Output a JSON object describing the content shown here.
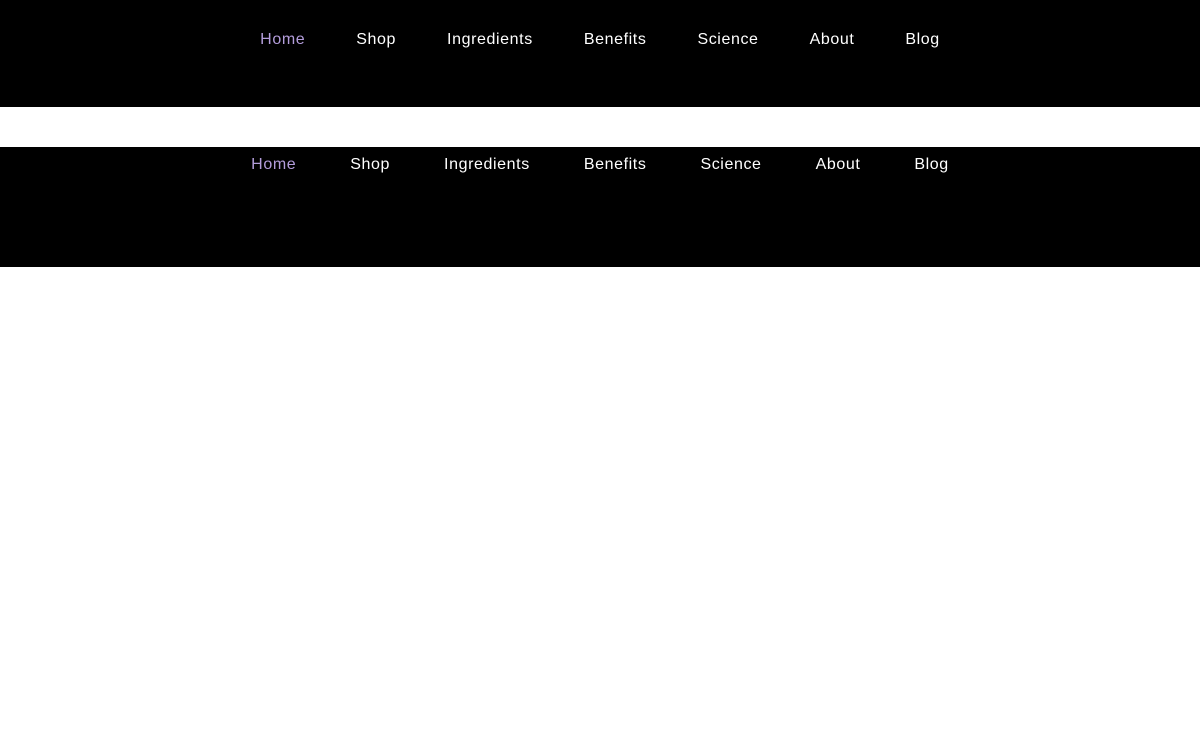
{
  "colors": {
    "nav_background": "#000000",
    "nav_text": "#ffffff",
    "nav_active": "#b39ddb",
    "page_background": "#ffffff"
  },
  "nav_top": {
    "items": [
      {
        "label": "Home",
        "active": true
      },
      {
        "label": "Shop",
        "active": false
      },
      {
        "label": "Ingredients",
        "active": false
      },
      {
        "label": "Benefits",
        "active": false
      },
      {
        "label": "Science",
        "active": false
      },
      {
        "label": "About",
        "active": false
      },
      {
        "label": "Blog",
        "active": false
      }
    ]
  },
  "nav_bottom": {
    "items": [
      {
        "label": "Home",
        "active": true
      },
      {
        "label": "Shop",
        "active": false
      },
      {
        "label": "Ingredients",
        "active": false
      },
      {
        "label": "Benefits",
        "active": false
      },
      {
        "label": "Science",
        "active": false
      },
      {
        "label": "About",
        "active": false
      },
      {
        "label": "Blog",
        "active": false
      }
    ]
  }
}
